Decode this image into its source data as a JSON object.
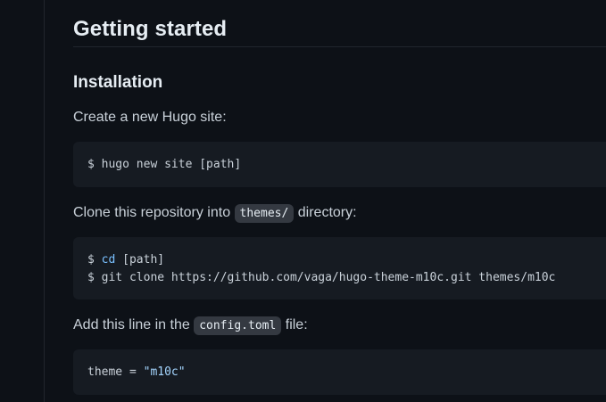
{
  "heading": "Getting started",
  "subheading": "Installation",
  "step1": {
    "text": "Create a new Hugo site:",
    "code": "$ hugo new site [path]"
  },
  "step2": {
    "text_before": "Clone this repository into ",
    "inline_code": "themes/",
    "text_after": " directory:",
    "line1_prompt": "$ ",
    "line1_cmd": "cd",
    "line1_rest": " [path]",
    "line2": "$ git clone https://github.com/vaga/hugo-theme-m10c.git themes/m10c"
  },
  "step3": {
    "text_before": "Add this line in the ",
    "inline_code": "config.toml",
    "text_after": " file:",
    "code_key": "theme = ",
    "code_value": "\"m10c\""
  },
  "colors": {
    "background": "#0d1117",
    "code_background": "#161b22",
    "inline_code_background": "#343941",
    "text": "#c9d1d9",
    "heading": "#e6edf3",
    "keyword": "#79c0ff",
    "string": "#a5d6ff"
  }
}
